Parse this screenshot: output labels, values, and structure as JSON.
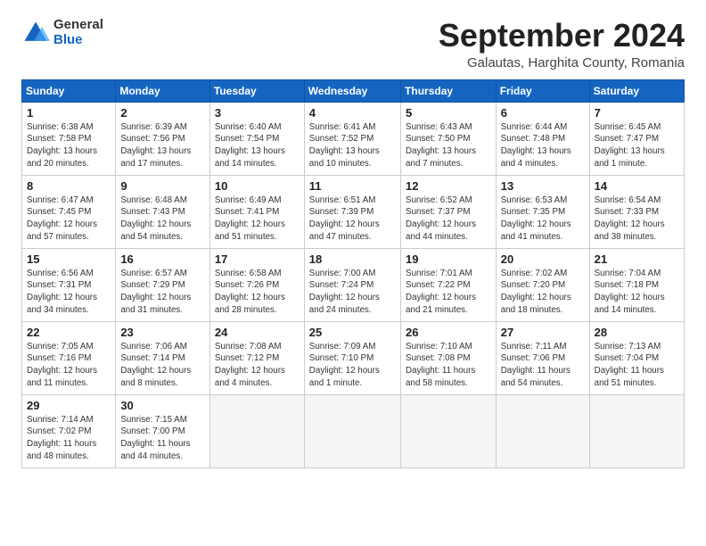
{
  "logo": {
    "general": "General",
    "blue": "Blue"
  },
  "title": "September 2024",
  "location": "Galautas, Harghita County, Romania",
  "headers": [
    "Sunday",
    "Monday",
    "Tuesday",
    "Wednesday",
    "Thursday",
    "Friday",
    "Saturday"
  ],
  "weeks": [
    [
      {
        "day": "1",
        "sunrise": "6:38 AM",
        "sunset": "7:58 PM",
        "daylight": "13 hours and 20 minutes."
      },
      {
        "day": "2",
        "sunrise": "6:39 AM",
        "sunset": "7:56 PM",
        "daylight": "13 hours and 17 minutes."
      },
      {
        "day": "3",
        "sunrise": "6:40 AM",
        "sunset": "7:54 PM",
        "daylight": "13 hours and 14 minutes."
      },
      {
        "day": "4",
        "sunrise": "6:41 AM",
        "sunset": "7:52 PM",
        "daylight": "13 hours and 10 minutes."
      },
      {
        "day": "5",
        "sunrise": "6:43 AM",
        "sunset": "7:50 PM",
        "daylight": "13 hours and 7 minutes."
      },
      {
        "day": "6",
        "sunrise": "6:44 AM",
        "sunset": "7:48 PM",
        "daylight": "13 hours and 4 minutes."
      },
      {
        "day": "7",
        "sunrise": "6:45 AM",
        "sunset": "7:47 PM",
        "daylight": "13 hours and 1 minute."
      }
    ],
    [
      {
        "day": "8",
        "sunrise": "6:47 AM",
        "sunset": "7:45 PM",
        "daylight": "12 hours and 57 minutes."
      },
      {
        "day": "9",
        "sunrise": "6:48 AM",
        "sunset": "7:43 PM",
        "daylight": "12 hours and 54 minutes."
      },
      {
        "day": "10",
        "sunrise": "6:49 AM",
        "sunset": "7:41 PM",
        "daylight": "12 hours and 51 minutes."
      },
      {
        "day": "11",
        "sunrise": "6:51 AM",
        "sunset": "7:39 PM",
        "daylight": "12 hours and 47 minutes."
      },
      {
        "day": "12",
        "sunrise": "6:52 AM",
        "sunset": "7:37 PM",
        "daylight": "12 hours and 44 minutes."
      },
      {
        "day": "13",
        "sunrise": "6:53 AM",
        "sunset": "7:35 PM",
        "daylight": "12 hours and 41 minutes."
      },
      {
        "day": "14",
        "sunrise": "6:54 AM",
        "sunset": "7:33 PM",
        "daylight": "12 hours and 38 minutes."
      }
    ],
    [
      {
        "day": "15",
        "sunrise": "6:56 AM",
        "sunset": "7:31 PM",
        "daylight": "12 hours and 34 minutes."
      },
      {
        "day": "16",
        "sunrise": "6:57 AM",
        "sunset": "7:29 PM",
        "daylight": "12 hours and 31 minutes."
      },
      {
        "day": "17",
        "sunrise": "6:58 AM",
        "sunset": "7:26 PM",
        "daylight": "12 hours and 28 minutes."
      },
      {
        "day": "18",
        "sunrise": "7:00 AM",
        "sunset": "7:24 PM",
        "daylight": "12 hours and 24 minutes."
      },
      {
        "day": "19",
        "sunrise": "7:01 AM",
        "sunset": "7:22 PM",
        "daylight": "12 hours and 21 minutes."
      },
      {
        "day": "20",
        "sunrise": "7:02 AM",
        "sunset": "7:20 PM",
        "daylight": "12 hours and 18 minutes."
      },
      {
        "day": "21",
        "sunrise": "7:04 AM",
        "sunset": "7:18 PM",
        "daylight": "12 hours and 14 minutes."
      }
    ],
    [
      {
        "day": "22",
        "sunrise": "7:05 AM",
        "sunset": "7:16 PM",
        "daylight": "12 hours and 11 minutes."
      },
      {
        "day": "23",
        "sunrise": "7:06 AM",
        "sunset": "7:14 PM",
        "daylight": "12 hours and 8 minutes."
      },
      {
        "day": "24",
        "sunrise": "7:08 AM",
        "sunset": "7:12 PM",
        "daylight": "12 hours and 4 minutes."
      },
      {
        "day": "25",
        "sunrise": "7:09 AM",
        "sunset": "7:10 PM",
        "daylight": "12 hours and 1 minute."
      },
      {
        "day": "26",
        "sunrise": "7:10 AM",
        "sunset": "7:08 PM",
        "daylight": "11 hours and 58 minutes."
      },
      {
        "day": "27",
        "sunrise": "7:11 AM",
        "sunset": "7:06 PM",
        "daylight": "11 hours and 54 minutes."
      },
      {
        "day": "28",
        "sunrise": "7:13 AM",
        "sunset": "7:04 PM",
        "daylight": "11 hours and 51 minutes."
      }
    ],
    [
      {
        "day": "29",
        "sunrise": "7:14 AM",
        "sunset": "7:02 PM",
        "daylight": "11 hours and 48 minutes."
      },
      {
        "day": "30",
        "sunrise": "7:15 AM",
        "sunset": "7:00 PM",
        "daylight": "11 hours and 44 minutes."
      },
      null,
      null,
      null,
      null,
      null
    ]
  ]
}
